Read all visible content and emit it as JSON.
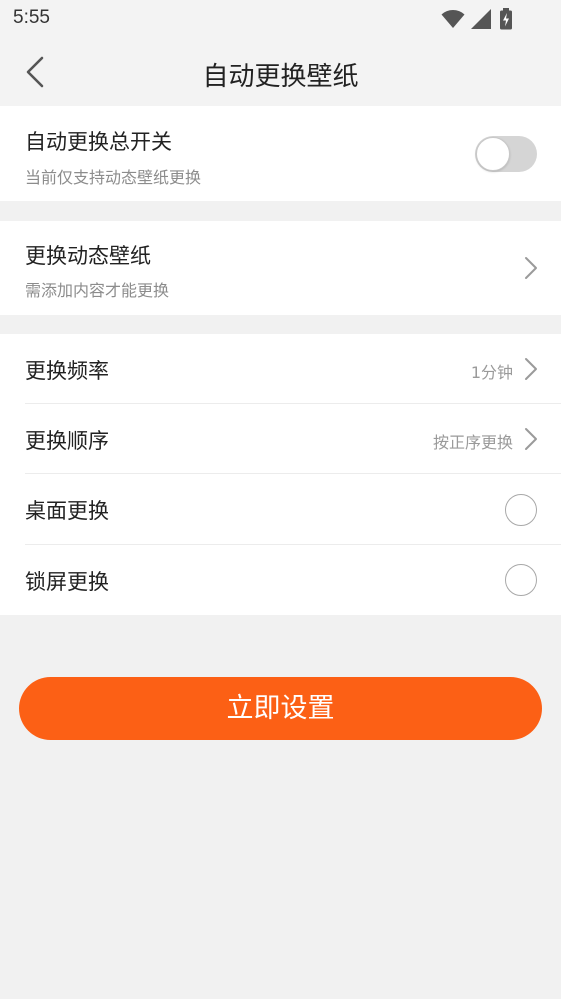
{
  "status_bar": {
    "time": "5:55",
    "icons": [
      "wifi-icon",
      "cellular-signal-icon",
      "battery-charging-icon"
    ]
  },
  "header": {
    "title": "自动更换壁纸",
    "back_icon": "chevron-left-icon"
  },
  "sections": {
    "master_switch": {
      "title": "自动更换总开关",
      "subtitle": "当前仅支持动态壁纸更换",
      "enabled": false
    },
    "dynamic_wallpaper": {
      "title": "更换动态壁纸",
      "subtitle": "需添加内容才能更换"
    },
    "settings": {
      "frequency_label": "更换频率",
      "frequency_value": "1分钟",
      "order_label": "更换顺序",
      "order_value": "按正序更换",
      "desktop_label": "桌面更换",
      "desktop_selected": false,
      "lockscreen_label": "锁屏更换",
      "lockscreen_selected": false
    }
  },
  "actions": {
    "apply_label": "立即设置"
  },
  "colors": {
    "accent": "#fc6015",
    "background": "#f1f1f1",
    "card": "#ffffff",
    "toggle_off": "#d5d5d5",
    "secondary_text": "#8c8c8c"
  }
}
